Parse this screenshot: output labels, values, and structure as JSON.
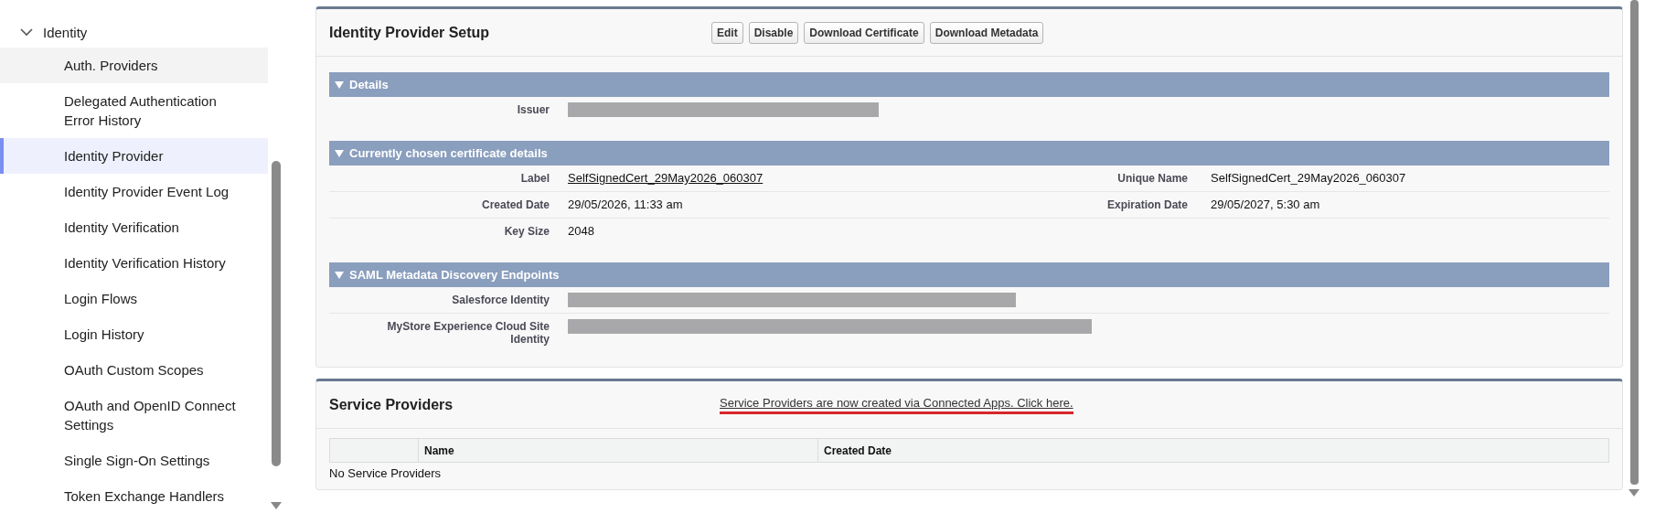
{
  "sidebar": {
    "items": [
      {
        "label": "Identity",
        "expanded": true,
        "children": [
          {
            "label": "Auth. Providers",
            "selected": false,
            "hovered": true
          },
          {
            "label": "Delegated Authentication Error History",
            "selected": false,
            "hovered": false
          },
          {
            "label": "Identity Provider",
            "selected": true,
            "hovered": false
          },
          {
            "label": "Identity Provider Event Log",
            "selected": false,
            "hovered": false
          },
          {
            "label": "Identity Verification",
            "selected": false,
            "hovered": false
          },
          {
            "label": "Identity Verification History",
            "selected": false,
            "hovered": false
          },
          {
            "label": "Login Flows",
            "selected": false,
            "hovered": false
          },
          {
            "label": "Login History",
            "selected": false,
            "hovered": false
          },
          {
            "label": "OAuth Custom Scopes",
            "selected": false,
            "hovered": false
          },
          {
            "label": "OAuth and OpenID Connect Settings",
            "selected": false,
            "hovered": false
          },
          {
            "label": "Single Sign-On Settings",
            "selected": false,
            "hovered": false
          },
          {
            "label": "Token Exchange Handlers",
            "selected": false,
            "hovered": false
          }
        ]
      }
    ]
  },
  "setup": {
    "title": "Identity Provider Setup",
    "buttons": [
      "Edit",
      "Disable",
      "Download Certificate",
      "Download Metadata"
    ],
    "sections": [
      {
        "title": "Details",
        "expanded": true,
        "rows": [
          {
            "cells": [
              {
                "label": "Issuer",
                "kind": "redacted"
              }
            ]
          }
        ]
      },
      {
        "title": "Currently chosen certificate details",
        "expanded": true,
        "rows": [
          {
            "cells": [
              {
                "label": "Label",
                "kind": "link",
                "value": "SelfSignedCert_29May2026_060307"
              },
              {
                "label": "Unique Name",
                "kind": "text",
                "value": "SelfSignedCert_29May2026_060307"
              }
            ]
          },
          {
            "cells": [
              {
                "label": "Created Date",
                "kind": "text",
                "value": "29/05/2026, 11:33 am"
              },
              {
                "label": "Expiration Date",
                "kind": "text",
                "value": "29/05/2027, 5:30 am"
              }
            ]
          },
          {
            "cells": [
              {
                "label": "Key Size",
                "kind": "text",
                "value": "2048"
              }
            ]
          }
        ]
      },
      {
        "title": "SAML Metadata Discovery Endpoints",
        "expanded": true,
        "rows": [
          {
            "cells": [
              {
                "label": "Salesforce Identity",
                "kind": "redacted"
              }
            ]
          },
          {
            "cells": [
              {
                "label": "MyStore Experience Cloud Site Identity",
                "kind": "redacted"
              }
            ]
          }
        ]
      }
    ]
  },
  "service_providers": {
    "title": "Service Providers",
    "notice": "Service Providers are now created via Connected Apps. Click here.",
    "columns": [
      "Name",
      "Created Date"
    ],
    "empty_text": "No Service Providers"
  }
}
